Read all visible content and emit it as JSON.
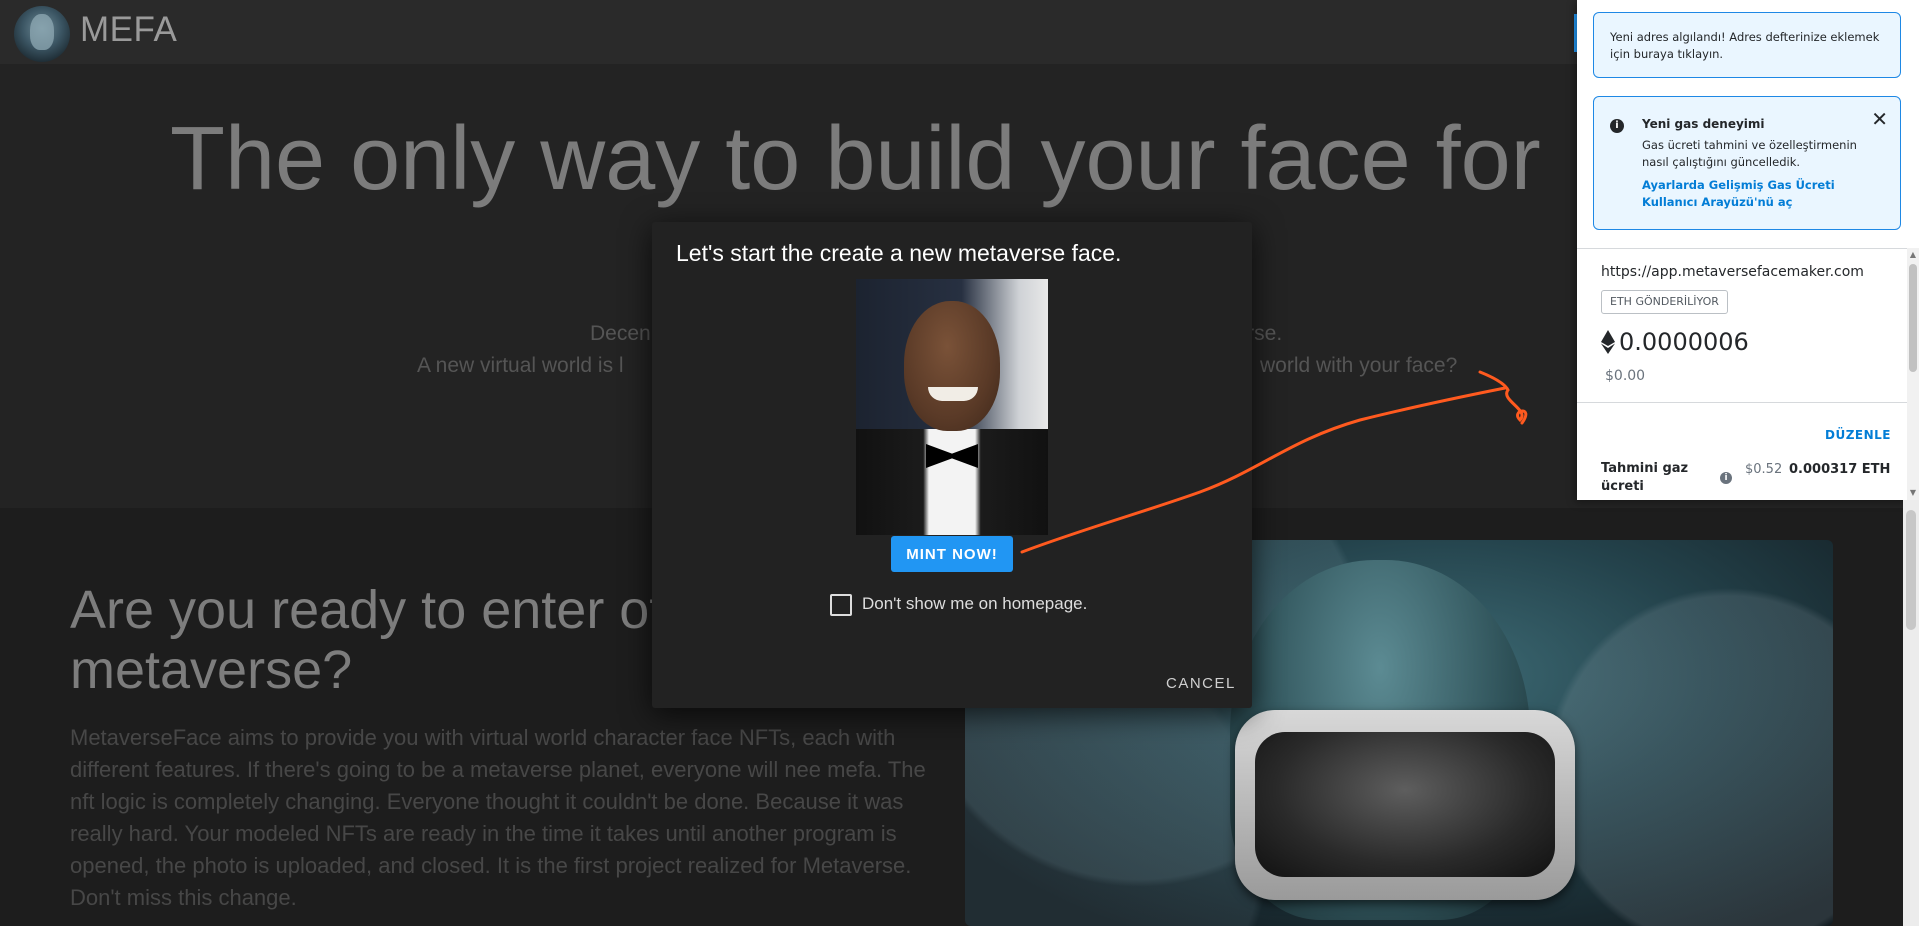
{
  "navbar": {
    "brand": "MEFA"
  },
  "hero": {
    "title": "The only way to build your face for",
    "subtitle1_left": "Decen",
    "subtitle1_right": "verse.",
    "subtitle2_left": "A new virtual world is l",
    "subtitle2_right": "world with your face?"
  },
  "section": {
    "title": "Are you ready to enter of the metaverse?",
    "body": "MetaverseFace aims to provide you with virtual world character face NFTs, each with different features. If there's going to be a metaverse planet, everyone will nee mefa. The nft logic is completely changing. Everyone thought it couldn't be done. Because it was really hard. Your modeled NFTs are ready in the time it takes until another program is opened, the photo is uploaded, and closed. It is the first project realized for Metaverse. Don't miss this change."
  },
  "modal": {
    "title": "Let's start the create a new metaverse face.",
    "mint_label": "MINT NOW!",
    "checkbox_label": "Don't show me on homepage.",
    "checkbox_checked": false,
    "cancel_label": "CANCEL"
  },
  "metamask": {
    "alert_new_address": "Yeni adres algılandı! Adres defterinize eklemek için buraya tıklayın.",
    "alert_gas_title": "Yeni gas deneyimi",
    "alert_gas_desc": "Gas ücreti tahmini ve özelleştirmenin nasıl çalıştığını güncelledik.",
    "alert_gas_link": "Ayarlarda Gelişmiş Gas Ücreti Kullanıcı Arayüzü'nü aç",
    "origin": "https://app.metaversefacemaker.com",
    "badge": "ETH GÖNDERİLİYOR",
    "amount": "0.0000006",
    "fiat": "$0.00",
    "edit_label": "DÜZENLE",
    "gas_label": "Tahmini gaz ücreti",
    "gas_usd": "$0.52",
    "gas_eth": "0.000317 ETH"
  },
  "colors": {
    "accent": "#2196f3",
    "annotation_arrow": "#ff5a1f",
    "metamask_link": "#037dd6"
  }
}
